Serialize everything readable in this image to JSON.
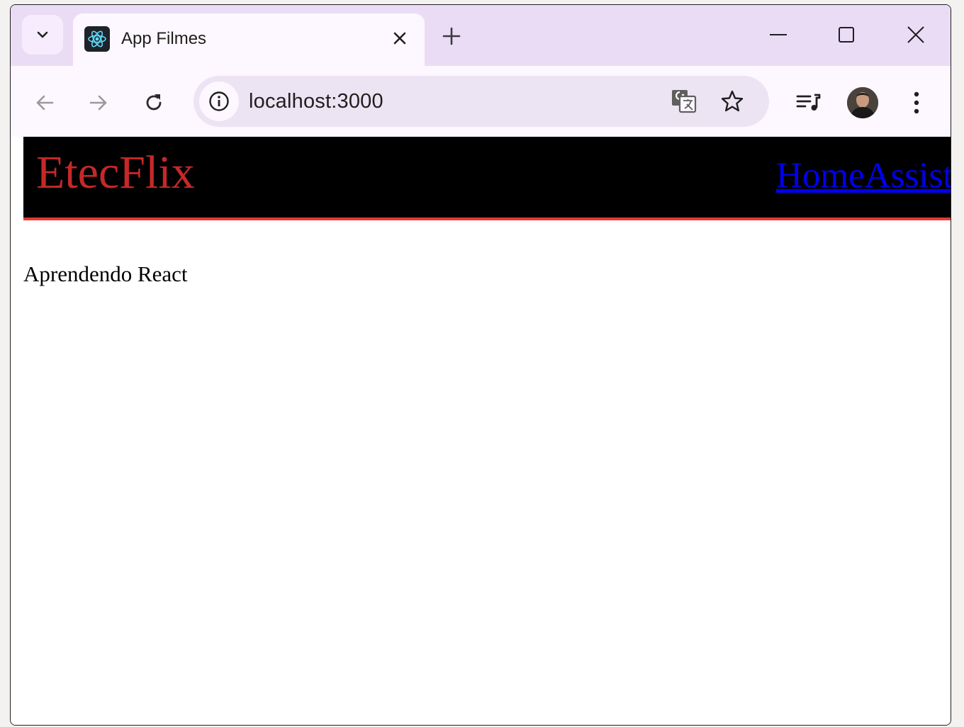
{
  "browser": {
    "tab": {
      "title": "App Filmes",
      "favicon": "react-logo-icon"
    },
    "address_bar": {
      "url": "localhost:3000"
    },
    "icons": {
      "tab_search": "chevron-down-icon",
      "tab_close": "close-icon",
      "new_tab": "plus-icon",
      "minimize": "minimize-icon",
      "maximize": "maximize-icon",
      "close_window": "close-window-icon",
      "back": "arrow-left-icon",
      "forward": "arrow-right-icon",
      "reload": "reload-icon",
      "site_info": "info-icon",
      "translate": "translate-icon",
      "bookmark": "star-icon",
      "media": "media-queue-icon",
      "profile": "avatar",
      "menu": "kebab-menu-icon"
    },
    "colors": {
      "tabstrip": "#ebdcf5",
      "toolbar": "#fdf7ff",
      "omnibox": "#ede4f3"
    }
  },
  "page": {
    "header": {
      "brand": "EtecFlix",
      "nav": [
        {
          "label": "Home"
        },
        {
          "label": "Assistir"
        }
      ]
    },
    "body_text": "Aprendendo React",
    "colors": {
      "header_bg": "#000000",
      "brand": "#c62828",
      "header_border": "#e53935",
      "link": "#0000ee"
    }
  }
}
